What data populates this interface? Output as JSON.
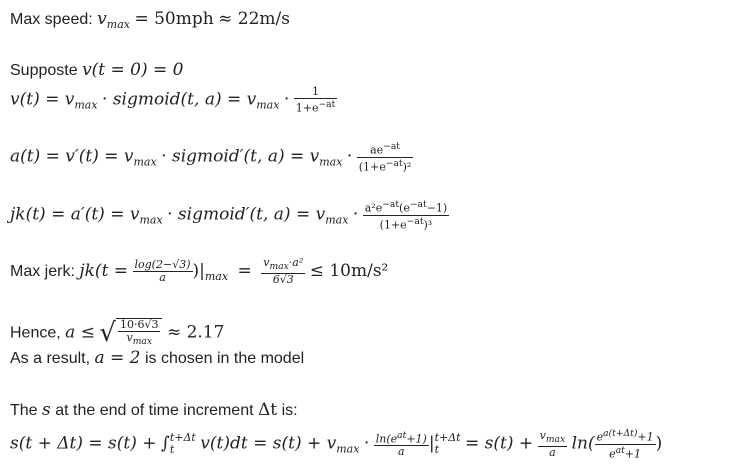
{
  "l1": {
    "label": "Max speed:",
    "lhs": "v",
    "sub": "max",
    "eq": "= 50mph",
    "approx": "≈ 22m/s"
  },
  "l2": {
    "label": "Supposte",
    "expr": "v(t = 0) = 0"
  },
  "l3": {
    "lhs": "v(t) = v",
    "sub": "max",
    "mid": "· sigmoid(t, a) = v",
    "sub2": "max",
    "dot": "·",
    "num": "1",
    "den": "1+e",
    "den_sup": "−at"
  },
  "l4": {
    "lhs": "a(t) = v′(t) = v",
    "sub": "max",
    "mid": "· sigmoid′(t, a) = v",
    "sub2": "max",
    "dot": "·",
    "num": "ae",
    "num_sup": "−at",
    "den": "(1+e",
    "den_sup": "−at",
    "den_end": ")²"
  },
  "l5": {
    "lhs": "jk(t) = a′(t) = v",
    "sub": "max",
    "mid": "· sigmoid′(t, a) = v",
    "sub2": "max",
    "dot": "·",
    "num": "a²e",
    "num_sup": "−at",
    "num_mid": "(e",
    "num_sup2": "−at",
    "num_end": "−1)",
    "den": "(1+e",
    "den_sup": "−at",
    "den_end": ")³"
  },
  "l6": {
    "label": "Max jerk:",
    "lhs": "jk(t =",
    "num": "log(2−√3)",
    "den": "a",
    "after": ")|",
    "sub": "max",
    "eq": "=",
    "num2": "v",
    "num2_sub": "max",
    "num2_end": "·a²",
    "den2": "6√3",
    "rhs": "≤ 10m/s²"
  },
  "l7": {
    "label": "Hence,",
    "lhs": "a ≤",
    "num": "10·6√3",
    "den": "v",
    "den_sub": "max",
    "rhs": "≈ 2.17"
  },
  "l8": {
    "pre": "As a result,",
    "expr": "a = 2",
    "post": "is chosen in the model"
  },
  "l9": {
    "pre": "The",
    "s": "s",
    "mid": "at the end of time increment",
    "dt": "Δt",
    "post": "is:"
  },
  "l10": {
    "lhs": "s(t + Δt) = s(t) +",
    "int": "∫",
    "up": "t+Δt",
    "lo": "t",
    "body": "v(t)dt = s(t) + v",
    "sub": "max",
    "dot": "·",
    "num": "ln(e",
    "num_sup": "at",
    "num_end": "+1)",
    "den": "a",
    "bar": "|",
    "bup": "t+Δt",
    "blo": "t",
    "eq2": "= s(t) +",
    "num2": "v",
    "num2_sub": "max",
    "den2": "a",
    "ln": "ln(",
    "num3": "e",
    "num3_sup": "a(t+Δt)",
    "num3_end": "+1",
    "den3": "e",
    "den3_sup": "at",
    "den3_end": "+1",
    "close": ")"
  }
}
